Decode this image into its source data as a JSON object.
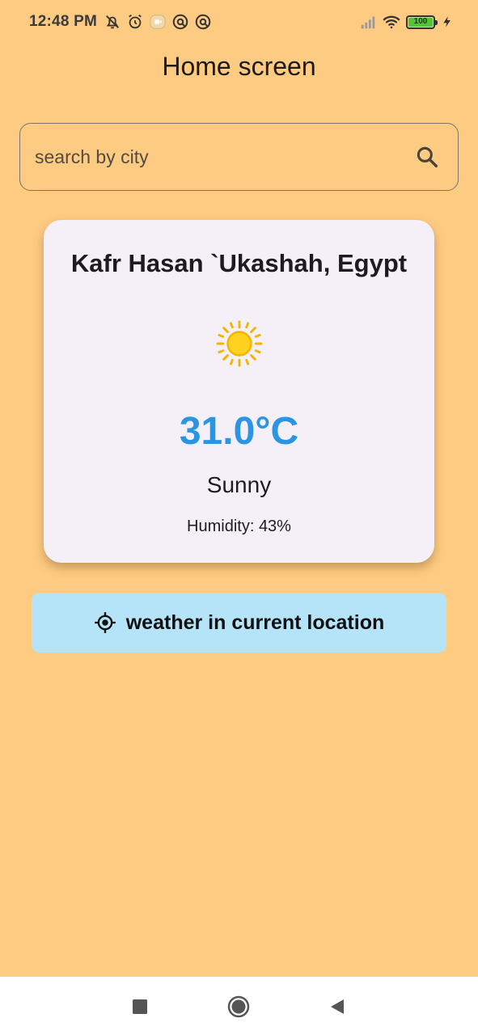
{
  "status_bar": {
    "time": "12:48 PM",
    "battery_level": "100",
    "left_icons": [
      "bell-off-icon",
      "alarm-icon",
      "screen-record-icon",
      "vpn-icon",
      "vpn-icon"
    ],
    "right_icons": [
      "signal-icon",
      "wifi-icon",
      "battery-icon",
      "charging-icon"
    ]
  },
  "app_bar": {
    "title": "Home screen"
  },
  "search": {
    "placeholder": "search by city",
    "value": ""
  },
  "weather_card": {
    "city": "Kafr Hasan `Ukashah, Egypt",
    "icon": "sun-icon",
    "temperature": "31.0°C",
    "condition": "Sunny",
    "humidity": "Humidity: 43%"
  },
  "location_button": {
    "label": "weather in current location",
    "icon": "my-location-icon"
  },
  "nav_bar": {
    "buttons": [
      "recents-button",
      "home-button",
      "back-button"
    ]
  },
  "colors": {
    "background": "#FECB82",
    "card": "#F5F0F8",
    "temperature": "#2B95E3",
    "location_button": "#B5E3F8",
    "battery": "#56C13A"
  }
}
